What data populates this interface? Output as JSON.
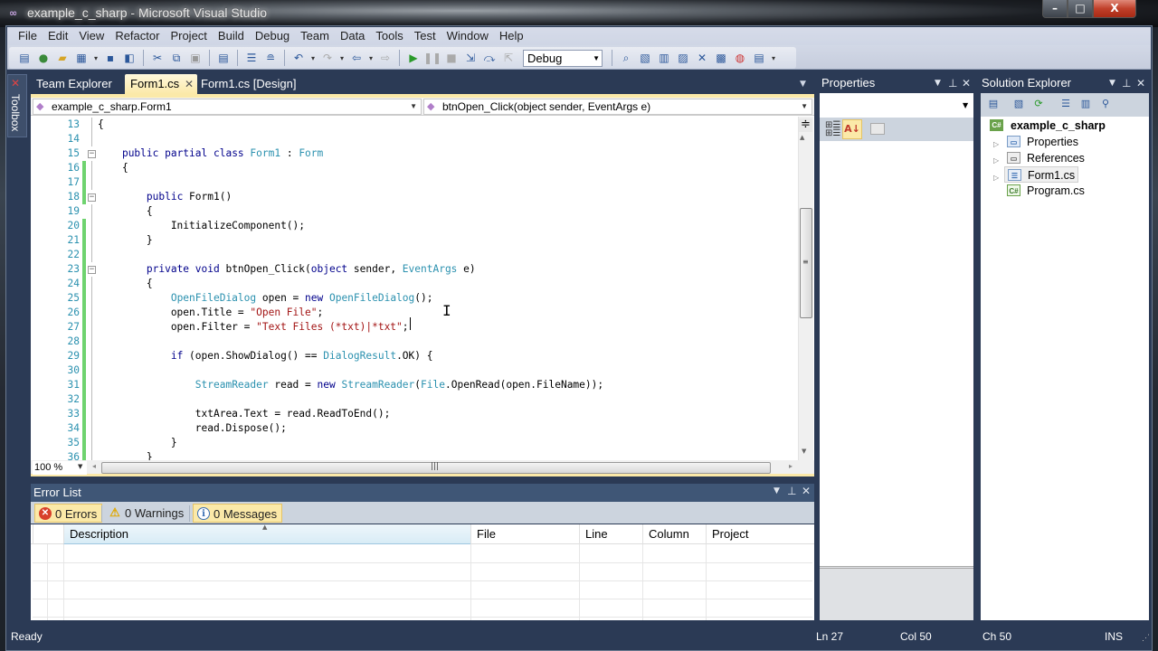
{
  "window": {
    "title": "example_c_sharp - Microsoft Visual Studio",
    "controls": {
      "minimize": "–",
      "maximize": "□",
      "close": "X"
    }
  },
  "menu": [
    "File",
    "Edit",
    "View",
    "Refactor",
    "Project",
    "Build",
    "Debug",
    "Team",
    "Data",
    "Tools",
    "Test",
    "Window",
    "Help"
  ],
  "toolbar": {
    "configuration": "Debug",
    "icons": [
      "new-project-icon",
      "add-item-icon",
      "open-file-icon",
      "add-new-item-icon",
      "save-icon",
      "save-all-icon",
      "cut-icon",
      "copy-icon",
      "paste-icon",
      "find-icon",
      "comment-icon",
      "uncomment-icon",
      "undo-icon",
      "redo-icon",
      "navigate-back-icon",
      "navigate-forward-icon",
      "start-debugging-icon",
      "break-all-icon",
      "stop-debugging-icon",
      "step-into-icon",
      "step-over-icon",
      "step-out-icon"
    ],
    "right_icons": [
      "find-in-files-icon",
      "solution-explorer-icon",
      "properties-icon",
      "object-browser-icon",
      "toolbox-icon",
      "class-view-icon",
      "error-list-icon",
      "start-page-icon"
    ]
  },
  "toolbox": {
    "label": "Toolbox"
  },
  "doc_tabs": [
    {
      "label": "Team Explorer",
      "active": false
    },
    {
      "label": "Form1.cs",
      "active": true
    },
    {
      "label": "Form1.cs [Design]",
      "active": false
    }
  ],
  "editor": {
    "class_dropdown": "example_c_sharp.Form1",
    "member_dropdown": "btnOpen_Click(object sender, EventArgs e)",
    "zoom": "100 %",
    "lines": [
      {
        "n": "13",
        "tokens": [
          [
            "",
            "{"
          ]
        ]
      },
      {
        "n": "14",
        "tokens": []
      },
      {
        "n": "15",
        "tokens": [
          [
            "",
            "    "
          ],
          [
            "kw",
            "public partial class "
          ],
          [
            "ty",
            "Form1"
          ],
          [
            "",
            " : "
          ],
          [
            "ty",
            "Form"
          ]
        ]
      },
      {
        "n": "16",
        "tokens": [
          [
            "",
            "    {"
          ]
        ]
      },
      {
        "n": "17",
        "tokens": []
      },
      {
        "n": "18",
        "tokens": [
          [
            "",
            "        "
          ],
          [
            "kw",
            "public "
          ],
          [
            "",
            "Form1()"
          ]
        ]
      },
      {
        "n": "19",
        "tokens": [
          [
            "",
            "        {"
          ]
        ]
      },
      {
        "n": "20",
        "tokens": [
          [
            "",
            "            InitializeComponent();"
          ]
        ]
      },
      {
        "n": "21",
        "tokens": [
          [
            "",
            "        }"
          ]
        ]
      },
      {
        "n": "22",
        "tokens": []
      },
      {
        "n": "23",
        "tokens": [
          [
            "",
            "        "
          ],
          [
            "kw",
            "private void "
          ],
          [
            "",
            "btnOpen_Click("
          ],
          [
            "kw",
            "object"
          ],
          [
            "",
            " sender, "
          ],
          [
            "ty",
            "EventArgs"
          ],
          [
            "",
            " e)"
          ]
        ]
      },
      {
        "n": "24",
        "tokens": [
          [
            "",
            "        {"
          ]
        ]
      },
      {
        "n": "25",
        "tokens": [
          [
            "",
            "            "
          ],
          [
            "ty",
            "OpenFileDialog"
          ],
          [
            "",
            " open = "
          ],
          [
            "kw",
            "new "
          ],
          [
            "ty",
            "OpenFileDialog"
          ],
          [
            "",
            "();"
          ]
        ]
      },
      {
        "n": "26",
        "tokens": [
          [
            "",
            "            open.Title = "
          ],
          [
            "st",
            "\"Open File\""
          ],
          [
            "",
            ";"
          ]
        ]
      },
      {
        "n": "27",
        "tokens": [
          [
            "",
            "            open.Filter = "
          ],
          [
            "st",
            "\"Text Files (*txt)|*txt\""
          ],
          [
            "",
            ";"
          ]
        ]
      },
      {
        "n": "28",
        "tokens": []
      },
      {
        "n": "29",
        "tokens": [
          [
            "",
            "            "
          ],
          [
            "kw",
            "if"
          ],
          [
            "",
            " (open.ShowDialog() == "
          ],
          [
            "ty",
            "DialogResult"
          ],
          [
            "",
            ".OK) {"
          ]
        ]
      },
      {
        "n": "30",
        "tokens": []
      },
      {
        "n": "31",
        "tokens": [
          [
            "",
            "                "
          ],
          [
            "ty",
            "StreamReader"
          ],
          [
            "",
            " read = "
          ],
          [
            "kw",
            "new "
          ],
          [
            "ty",
            "StreamReader"
          ],
          [
            "",
            "("
          ],
          [
            "ty",
            "File"
          ],
          [
            "",
            ".OpenRead(open.FileName));"
          ]
        ]
      },
      {
        "n": "32",
        "tokens": []
      },
      {
        "n": "33",
        "tokens": [
          [
            "",
            "                txtArea.Text = read.ReadToEnd();"
          ]
        ]
      },
      {
        "n": "34",
        "tokens": [
          [
            "",
            "                read.Dispose();"
          ]
        ]
      },
      {
        "n": "35",
        "tokens": [
          [
            "",
            "            }"
          ]
        ]
      },
      {
        "n": "36",
        "tokens": [
          [
            "",
            "        }"
          ]
        ]
      }
    ]
  },
  "error_list": {
    "title": "Error List",
    "filters": {
      "errors": "0 Errors",
      "warnings": "0 Warnings",
      "messages": "0 Messages"
    },
    "columns": [
      "Description",
      "File",
      "Line",
      "Column",
      "Project"
    ]
  },
  "properties": {
    "title": "Properties",
    "selected_object": ""
  },
  "solution_explorer": {
    "title": "Solution Explorer",
    "root": "example_c_sharp",
    "items": [
      "Properties",
      "References",
      "Form1.cs",
      "Program.cs"
    ]
  },
  "status": {
    "text": "Ready",
    "line": "Ln 27",
    "col": "Col 50",
    "ch": "Ch 50",
    "mode": "INS"
  },
  "colors": {
    "accent_tab": "#fbe9a8",
    "frame": "#2b3a55",
    "keyword": "#00008b",
    "type": "#2b91af",
    "string": "#a31515",
    "changed_marker": "#6fd36f"
  }
}
